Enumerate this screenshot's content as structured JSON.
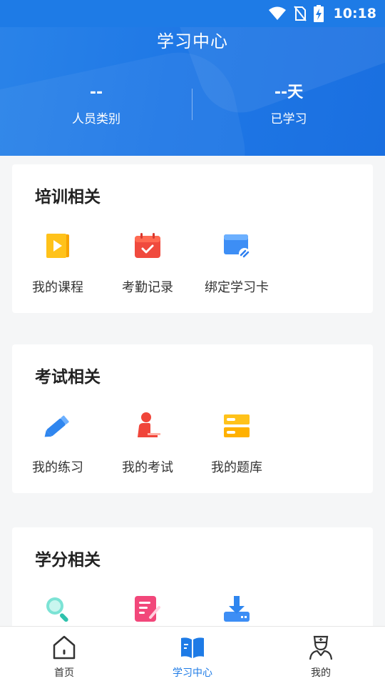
{
  "status_bar": {
    "time": "10:18"
  },
  "header": {
    "title": "学习中心",
    "stats": [
      {
        "value": "--",
        "label": "人员类别"
      },
      {
        "value": "--天",
        "label": "已学习"
      }
    ]
  },
  "sections": [
    {
      "title": "培训相关",
      "items": [
        {
          "label": "我的课程",
          "icon": "play-video-icon"
        },
        {
          "label": "考勤记录",
          "icon": "calendar-check-icon"
        },
        {
          "label": "绑定学习卡",
          "icon": "card-link-icon"
        }
      ]
    },
    {
      "title": "考试相关",
      "items": [
        {
          "label": "我的练习",
          "icon": "pencil-icon"
        },
        {
          "label": "我的考试",
          "icon": "exam-person-icon"
        },
        {
          "label": "我的题库",
          "icon": "database-icon"
        }
      ]
    },
    {
      "title": "学分相关",
      "items": [
        {
          "label": "",
          "icon": "search-icon"
        },
        {
          "label": "",
          "icon": "edit-note-icon"
        },
        {
          "label": "",
          "icon": "download-icon"
        }
      ]
    }
  ],
  "bottom_nav": [
    {
      "label": "首页",
      "icon": "home-icon",
      "active": false
    },
    {
      "label": "学习中心",
      "icon": "book-icon",
      "active": true
    },
    {
      "label": "我的",
      "icon": "nurse-profile-icon",
      "active": false
    }
  ],
  "colors": {
    "primary": "#1e7be6",
    "background": "#f5f6f7"
  }
}
